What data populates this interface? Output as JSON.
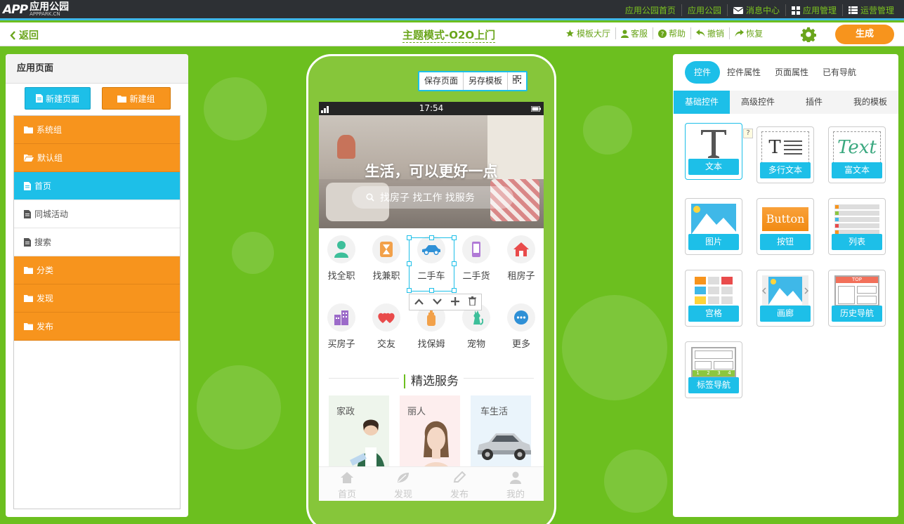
{
  "topbar": {
    "logo_mark": "APP",
    "logo_cn": "应用公园",
    "logo_en": "APPPARK.CN",
    "nav": [
      "应用公园首页",
      "应用公园",
      "消息中心",
      "应用管理",
      "运营管理"
    ]
  },
  "toolbar": {
    "back": "返回",
    "title": "主题模式-O2O上门",
    "tools": [
      "模板大厅",
      "客服",
      "帮助",
      "撤销",
      "恢复"
    ],
    "generate": "生成"
  },
  "left": {
    "header": "应用页面",
    "new_page": "新建页面",
    "new_group": "新建组",
    "rows": [
      {
        "label": "系统组",
        "type": "grp"
      },
      {
        "label": "默认组",
        "type": "grp"
      },
      {
        "label": "首页",
        "type": "act"
      },
      {
        "label": "同城活动",
        "type": "pg"
      },
      {
        "label": "搜索",
        "type": "pg"
      },
      {
        "label": "分类",
        "type": "grp"
      },
      {
        "label": "发现",
        "type": "grp"
      },
      {
        "label": "发布",
        "type": "grp"
      }
    ]
  },
  "phone": {
    "tools": [
      "保存页面",
      "另存模板"
    ],
    "time": "17:54",
    "hero_title": "生活，可以更好一点",
    "search_placeholder": "找房子 找工作 找服务",
    "icons_row1": [
      "找全职",
      "找兼职",
      "二手车",
      "二手货",
      "租房子"
    ],
    "icons_row2": [
      "买房子",
      "交友",
      "找保姆",
      "宠物",
      "更多"
    ],
    "section_title": "精选服务",
    "cards": [
      "家政",
      "丽人",
      "车生活"
    ],
    "tabs": [
      "首页",
      "发现",
      "发布",
      "我的"
    ]
  },
  "right": {
    "tabs": [
      "控件",
      "控件属性",
      "页面属性",
      "已有导航"
    ],
    "subtabs": [
      "基础控件",
      "高级控件",
      "插件",
      "我的模板"
    ],
    "widgets": [
      "文本",
      "多行文本",
      "富文本",
      "图片",
      "按钮",
      "列表",
      "宫格",
      "画廊",
      "历史导航",
      "标签导航"
    ],
    "art_text": {
      "multiline": "T",
      "richtext": "Text",
      "button": "Button",
      "top": "TOP",
      "tabnums": [
        "1",
        "2",
        "3",
        "4"
      ]
    },
    "help": "?"
  },
  "colors": {
    "green": "#6cbf1f",
    "blue": "#1dbfe8",
    "orange": "#f7941d",
    "dark": "#2d3034"
  }
}
